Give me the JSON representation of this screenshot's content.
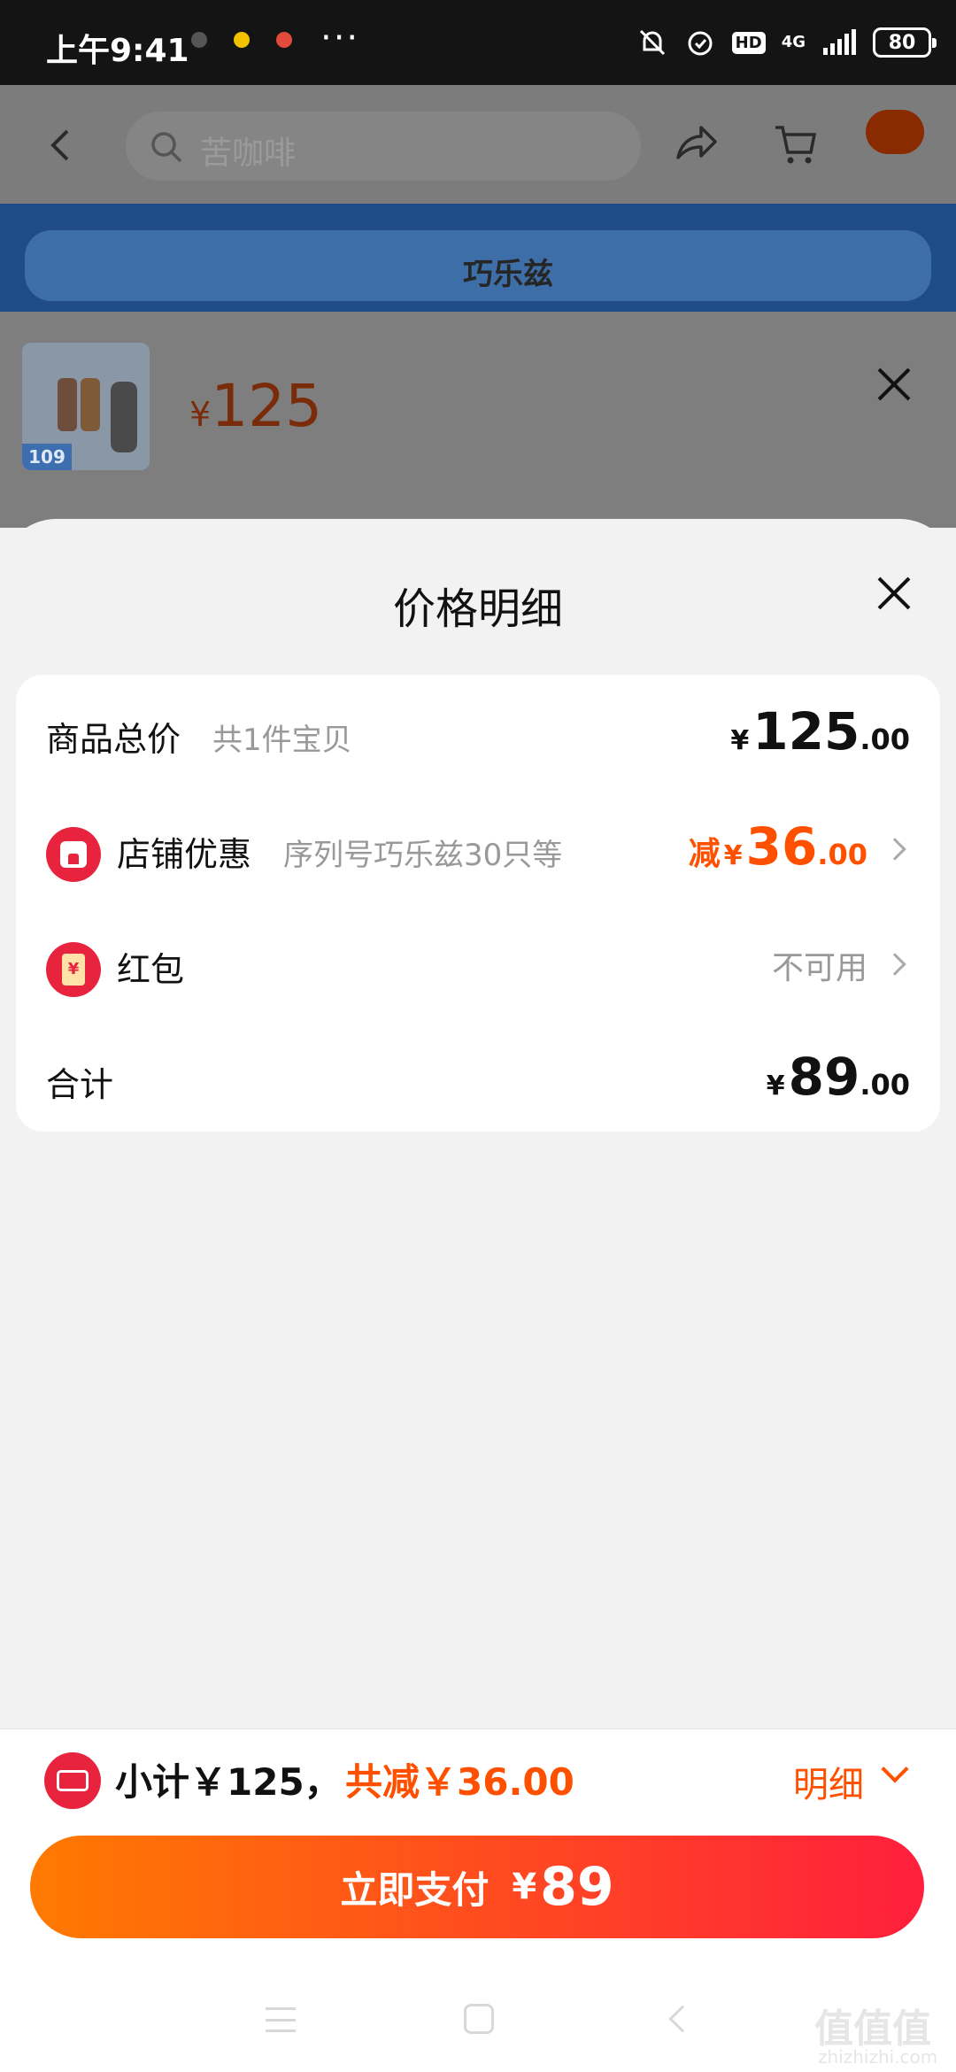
{
  "status_bar": {
    "time": "上午9:41",
    "dots": "···",
    "hd": "HD",
    "network": "4G",
    "battery": "80"
  },
  "background_page": {
    "search_placeholder": "苦咖啡",
    "banner_brand": "巧乐兹",
    "thumb_tag": "109",
    "price_currency": "¥",
    "price": "125"
  },
  "sheet": {
    "title": "价格明细",
    "rows": {
      "total": {
        "label": "商品总价",
        "sub": "共1件宝贝",
        "currency": "¥",
        "int": "125",
        "dec": ".00"
      },
      "shop": {
        "label": "店铺优惠",
        "sub": "序列号巧乐兹30只等",
        "prefix": "减",
        "currency": "¥",
        "int": "36",
        "dec": ".00"
      },
      "redpacket": {
        "label": "红包",
        "icon_char": "¥",
        "status": "不可用"
      },
      "sum": {
        "label": "合计",
        "currency": "¥",
        "int": "89",
        "dec": ".00"
      }
    }
  },
  "bottom_bar": {
    "subtotal": "小计￥125，",
    "saved": "共减￥36.00",
    "detail": "明细",
    "pay_label": "立即支付",
    "pay_currency": "¥",
    "pay_amount": "89"
  },
  "watermark": {
    "text": "值值值",
    "sub": "zhizhizhi.com"
  },
  "colors": {
    "accent": "#ff5000",
    "red_icon": "#e8233e",
    "pay_gradient_start": "#ff7a00",
    "pay_gradient_end": "#ff1f3d"
  }
}
